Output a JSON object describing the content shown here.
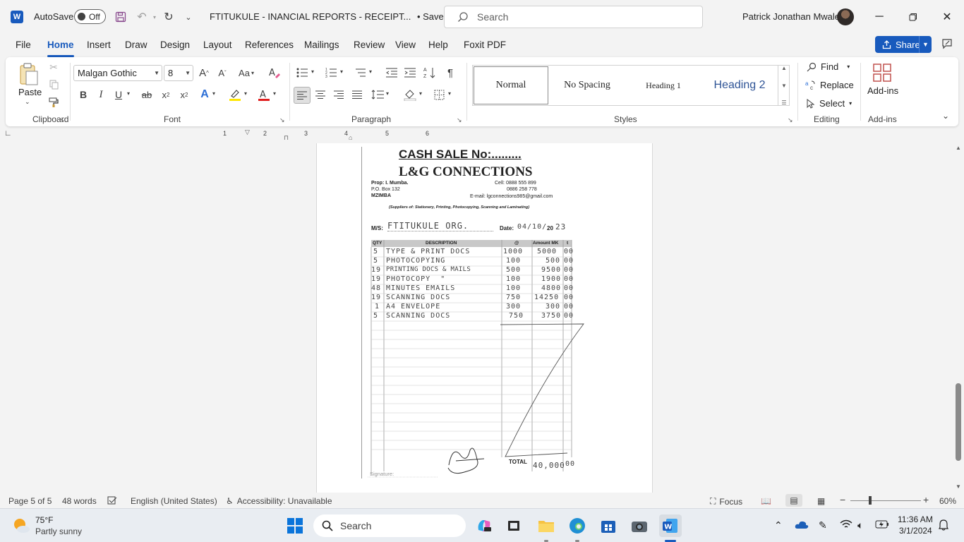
{
  "titlebar": {
    "autosave_label": "AutoSave",
    "autosave_state": "Off",
    "doc_title": "FTITUKULE - INANCIAL REPORTS - RECEIPT...",
    "save_status": "• Saved",
    "search_placeholder": "Search",
    "user_name": "Patrick Jonathan Mwale"
  },
  "tabs": [
    "File",
    "Home",
    "Insert",
    "Draw",
    "Design",
    "Layout",
    "References",
    "Mailings",
    "Review",
    "View",
    "Help",
    "Foxit PDF"
  ],
  "share_label": "Share",
  "ribbon": {
    "clipboard": {
      "paste": "Paste",
      "label": "Clipboard"
    },
    "font": {
      "family": "Malgan Gothic",
      "size": "8",
      "label": "Font"
    },
    "paragraph_label": "Paragraph",
    "styles": {
      "label": "Styles",
      "items": [
        "Normal",
        "No Spacing",
        "Heading 1",
        "Heading 2"
      ]
    },
    "editing": {
      "label": "Editing",
      "find": "Find",
      "replace": "Replace",
      "select": "Select"
    },
    "addins": {
      "button": "Add-ins",
      "label": "Add-ins"
    }
  },
  "ruler_numbers": [
    "1",
    "2",
    "3",
    "4",
    "5",
    "6"
  ],
  "receipt": {
    "title": "CASH SALE No:.........",
    "company": "L&G CONNECTIONS",
    "prop": "Prop: I. Mumba.",
    "box": "P.O. Box 132",
    "town": "MZIMBA",
    "cell1": "Cell: 0888 555 899",
    "cell2": "0886 258 778",
    "email": "E-mail: lgconnections985@gmail.com",
    "suppliers": "(Suppliers of: Stationery, Printing, Photocopying, Scanning and Laminating)",
    "ms_label": "M/S:",
    "ms_value": "FTITUKULE ORG.",
    "date_label": "Date:",
    "date_value": "04/10/",
    "date_year_prefix": "20",
    "date_year": "23",
    "columns": [
      "QTY",
      "DESCRIPTION",
      "@",
      "Amount MK",
      "t"
    ],
    "rows": [
      {
        "qty": "5",
        "desc": "TYPE & PRINT DOCS",
        "rate": "1000",
        "amount": "5000",
        "t": "00"
      },
      {
        "qty": "5",
        "desc": "PHOTOCOPYING",
        "rate": "100",
        "amount": "500",
        "t": "00"
      },
      {
        "qty": "19",
        "desc": "PRINTING DOCS & MAILS",
        "rate": "500",
        "amount": "9500",
        "t": "00"
      },
      {
        "qty": "19",
        "desc": "PHOTOCOPY  \"",
        "rate": "100",
        "amount": "1900",
        "t": "00"
      },
      {
        "qty": "48",
        "desc": "MINUTES EMAILS",
        "rate": "100",
        "amount": "4800",
        "t": "00"
      },
      {
        "qty": "19",
        "desc": "SCANNING DOCS",
        "rate": "750",
        "amount": "14250",
        "t": "00"
      },
      {
        "qty": "1",
        "desc": "A4 ENVELOPE",
        "rate": "300",
        "amount": "300",
        "t": "00"
      },
      {
        "qty": "5",
        "desc": "SCANNING DOCS",
        "rate": "750",
        "amount": "3750",
        "t": "00"
      }
    ],
    "total_label": "TOTAL",
    "total_value": "40,000",
    "total_t": "00",
    "signature_label": "Signature:"
  },
  "statusbar": {
    "page": "Page 5 of 5",
    "words": "48 words",
    "language": "English (United States)",
    "accessibility": "Accessibility: Unavailable",
    "focus": "Focus",
    "zoom": "60%"
  },
  "taskbar": {
    "weather_temp": "75°F",
    "weather_desc": "Partly sunny",
    "search": "Search",
    "time": "11:36 AM",
    "date": "3/1/2024"
  }
}
